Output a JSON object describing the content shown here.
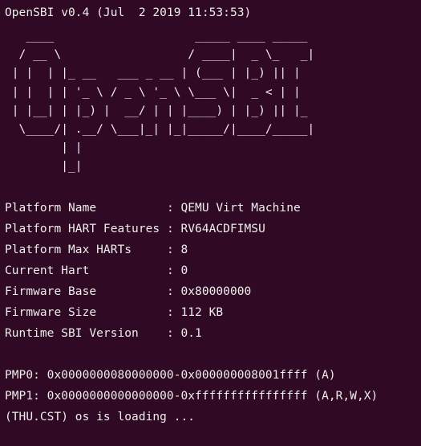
{
  "header": {
    "version_line": "OpenSBI v0.4 (Jul  2 2019 11:53:53)"
  },
  "logo": {
    "lines": [
      "   ____                    _____ ____ _____",
      "  / __ \\                  / ____|  _ \\_   _|",
      " | |  | |_ __   ___ _ __ | (___ | |_) || |",
      " | |  | | '_ \\ / _ \\ '_ \\ \\___ \\|  _ < | |",
      " | |__| | |_) |  __/ | | |____) | |_) || |_",
      "  \\____/| .__/ \\___|_| |_|_____/|____/_____|",
      "        | |",
      "        |_|"
    ]
  },
  "platform_info": [
    {
      "label": "Platform Name          ",
      "value": "QEMU Virt Machine"
    },
    {
      "label": "Platform HART Features ",
      "value": "RV64ACDFIMSU"
    },
    {
      "label": "Platform Max HARTs     ",
      "value": "8"
    },
    {
      "label": "Current Hart           ",
      "value": "0"
    },
    {
      "label": "Firmware Base          ",
      "value": "0x80000000"
    },
    {
      "label": "Firmware Size          ",
      "value": "112 KB"
    },
    {
      "label": "Runtime SBI Version    ",
      "value": "0.1"
    }
  ],
  "separator": ": ",
  "pmp": [
    "PMP0: 0x0000000080000000-0x000000008001ffff (A)",
    "PMP1: 0x0000000000000000-0xffffffffffffffff (A,R,W,X)"
  ],
  "status": {
    "loading_message": "(THU.CST) os is loading ..."
  },
  "colors": {
    "background": "#300a24",
    "foreground": "#eeeeec"
  }
}
